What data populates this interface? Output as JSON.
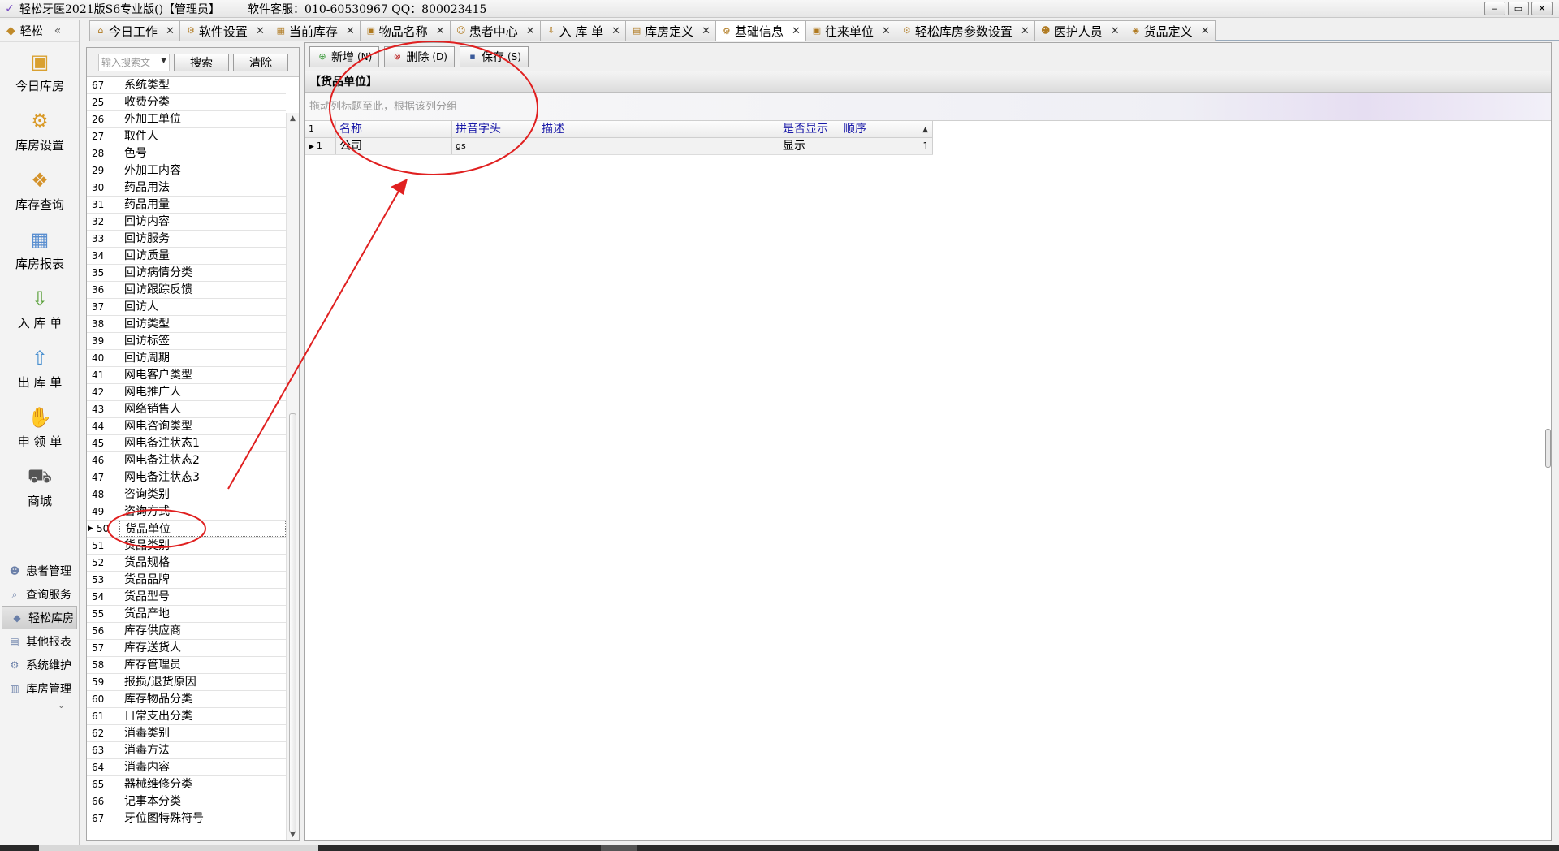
{
  "app": {
    "title": "轻松牙医2021版S6专业版()【管理员】",
    "service": "软件客服：010-60530967 QQ：800023415",
    "window_controls": [
      "‒",
      "▭",
      "✕"
    ]
  },
  "tabs": [
    {
      "label": "今日工作",
      "icon": "house-icon"
    },
    {
      "label": "软件设置",
      "icon": "gear-icon"
    },
    {
      "label": "当前库存",
      "icon": "grid-icon"
    },
    {
      "label": "物品名称",
      "icon": "box-icon"
    },
    {
      "label": "患者中心",
      "icon": "patient-icon"
    },
    {
      "label": "入 库 单",
      "icon": "inbound-icon"
    },
    {
      "label": "库房定义",
      "icon": "folder-icon"
    },
    {
      "label": "基础信息",
      "icon": "settings-icon",
      "active": true
    },
    {
      "label": "往来单位",
      "icon": "partner-icon"
    },
    {
      "label": "轻松库房参数设置",
      "icon": "gear-icon"
    },
    {
      "label": "医护人员",
      "icon": "staff-icon"
    },
    {
      "label": "货品定义",
      "icon": "tag-icon"
    }
  ],
  "leftnav": {
    "header": "轻松",
    "collapse": "«",
    "big_items": [
      {
        "label": "今日库房",
        "icon": "warehouse-today-icon"
      },
      {
        "label": "库房设置",
        "icon": "warehouse-settings-icon"
      },
      {
        "label": "库存查询",
        "icon": "stock-query-icon"
      },
      {
        "label": "库房报表",
        "icon": "report-icon"
      },
      {
        "label": "入 库 单",
        "icon": "inbound-icon"
      },
      {
        "label": "出 库 单",
        "icon": "outbound-icon"
      },
      {
        "label": "申 领 单",
        "icon": "hand-icon"
      },
      {
        "label": "商城",
        "icon": "cart-icon"
      }
    ],
    "small_items": [
      {
        "label": "患者管理",
        "icon": "patients-icon"
      },
      {
        "label": "查询服务",
        "icon": "query-icon"
      },
      {
        "label": "轻松库房",
        "icon": "warehouse-icon",
        "active": true
      },
      {
        "label": "其他报表",
        "icon": "other-report-icon"
      },
      {
        "label": "系统维护",
        "icon": "maintenance-icon"
      },
      {
        "label": "库房管理",
        "icon": "warehouse-manage-icon"
      }
    ],
    "more": "⌄"
  },
  "category_panel": {
    "search_placeholder": "输入搜索文",
    "search_button": "搜索",
    "clear_button": "清除",
    "rows": [
      {
        "num": "67",
        "name": "系统类型"
      },
      {
        "num": "25",
        "name": "收费分类"
      },
      {
        "num": "26",
        "name": "外加工单位"
      },
      {
        "num": "27",
        "name": "取件人"
      },
      {
        "num": "28",
        "name": "色号"
      },
      {
        "num": "29",
        "name": "外加工内容"
      },
      {
        "num": "30",
        "name": "药品用法"
      },
      {
        "num": "31",
        "name": "药品用量"
      },
      {
        "num": "32",
        "name": "回访内容"
      },
      {
        "num": "33",
        "name": "回访服务"
      },
      {
        "num": "34",
        "name": "回访质量"
      },
      {
        "num": "35",
        "name": "回访病情分类"
      },
      {
        "num": "36",
        "name": "回访跟踪反馈"
      },
      {
        "num": "37",
        "name": "回访人"
      },
      {
        "num": "38",
        "name": "回访类型"
      },
      {
        "num": "39",
        "name": "回访标签"
      },
      {
        "num": "40",
        "name": "回访周期"
      },
      {
        "num": "41",
        "name": "网电客户类型"
      },
      {
        "num": "42",
        "name": "网电推广人"
      },
      {
        "num": "43",
        "name": "网络销售人"
      },
      {
        "num": "44",
        "name": "网电咨询类型"
      },
      {
        "num": "45",
        "name": "网电备注状态1"
      },
      {
        "num": "46",
        "name": "网电备注状态2"
      },
      {
        "num": "47",
        "name": "网电备注状态3"
      },
      {
        "num": "48",
        "name": "咨询类别"
      },
      {
        "num": "49",
        "name": "咨询方式"
      },
      {
        "num": "50",
        "name": "货品单位",
        "selected": true
      },
      {
        "num": "51",
        "name": "货品类别"
      },
      {
        "num": "52",
        "name": "货品规格"
      },
      {
        "num": "53",
        "name": "货品品牌"
      },
      {
        "num": "54",
        "name": "货品型号"
      },
      {
        "num": "55",
        "name": "货品产地"
      },
      {
        "num": "56",
        "name": "库存供应商"
      },
      {
        "num": "57",
        "name": "库存送货人"
      },
      {
        "num": "58",
        "name": "库存管理员"
      },
      {
        "num": "59",
        "name": "报损/退货原因"
      },
      {
        "num": "60",
        "name": "库存物品分类"
      },
      {
        "num": "61",
        "name": "日常支出分类"
      },
      {
        "num": "62",
        "name": "消毒类别"
      },
      {
        "num": "63",
        "name": "消毒方法"
      },
      {
        "num": "64",
        "name": "消毒内容"
      },
      {
        "num": "65",
        "name": "器械维修分类"
      },
      {
        "num": "66",
        "name": "记事本分类"
      },
      {
        "num": "67",
        "name": "牙位图特殊符号"
      }
    ]
  },
  "main": {
    "toolbar": [
      {
        "label": "新增",
        "shortcut": "(N)",
        "icon": "add-icon"
      },
      {
        "label": "删除",
        "shortcut": "(D)",
        "icon": "delete-icon"
      },
      {
        "label": "保存",
        "shortcut": "(S)",
        "icon": "save-icon"
      }
    ],
    "section_title": "【货品单位】",
    "group_hint": "拖动列标题至此，根据该列分组",
    "grid": {
      "row_count": "1",
      "columns": [
        "名称",
        "拼音字头",
        "描述",
        "是否显示",
        "顺序"
      ],
      "rows": [
        {
          "index": "1",
          "name": "公司",
          "pinyin": "gs",
          "desc": "",
          "show": "显示",
          "order": "1"
        }
      ]
    }
  },
  "colors": {
    "header_text": "#1a1aa8",
    "annotation": "#e02020",
    "accent": "#7a4fc4"
  }
}
